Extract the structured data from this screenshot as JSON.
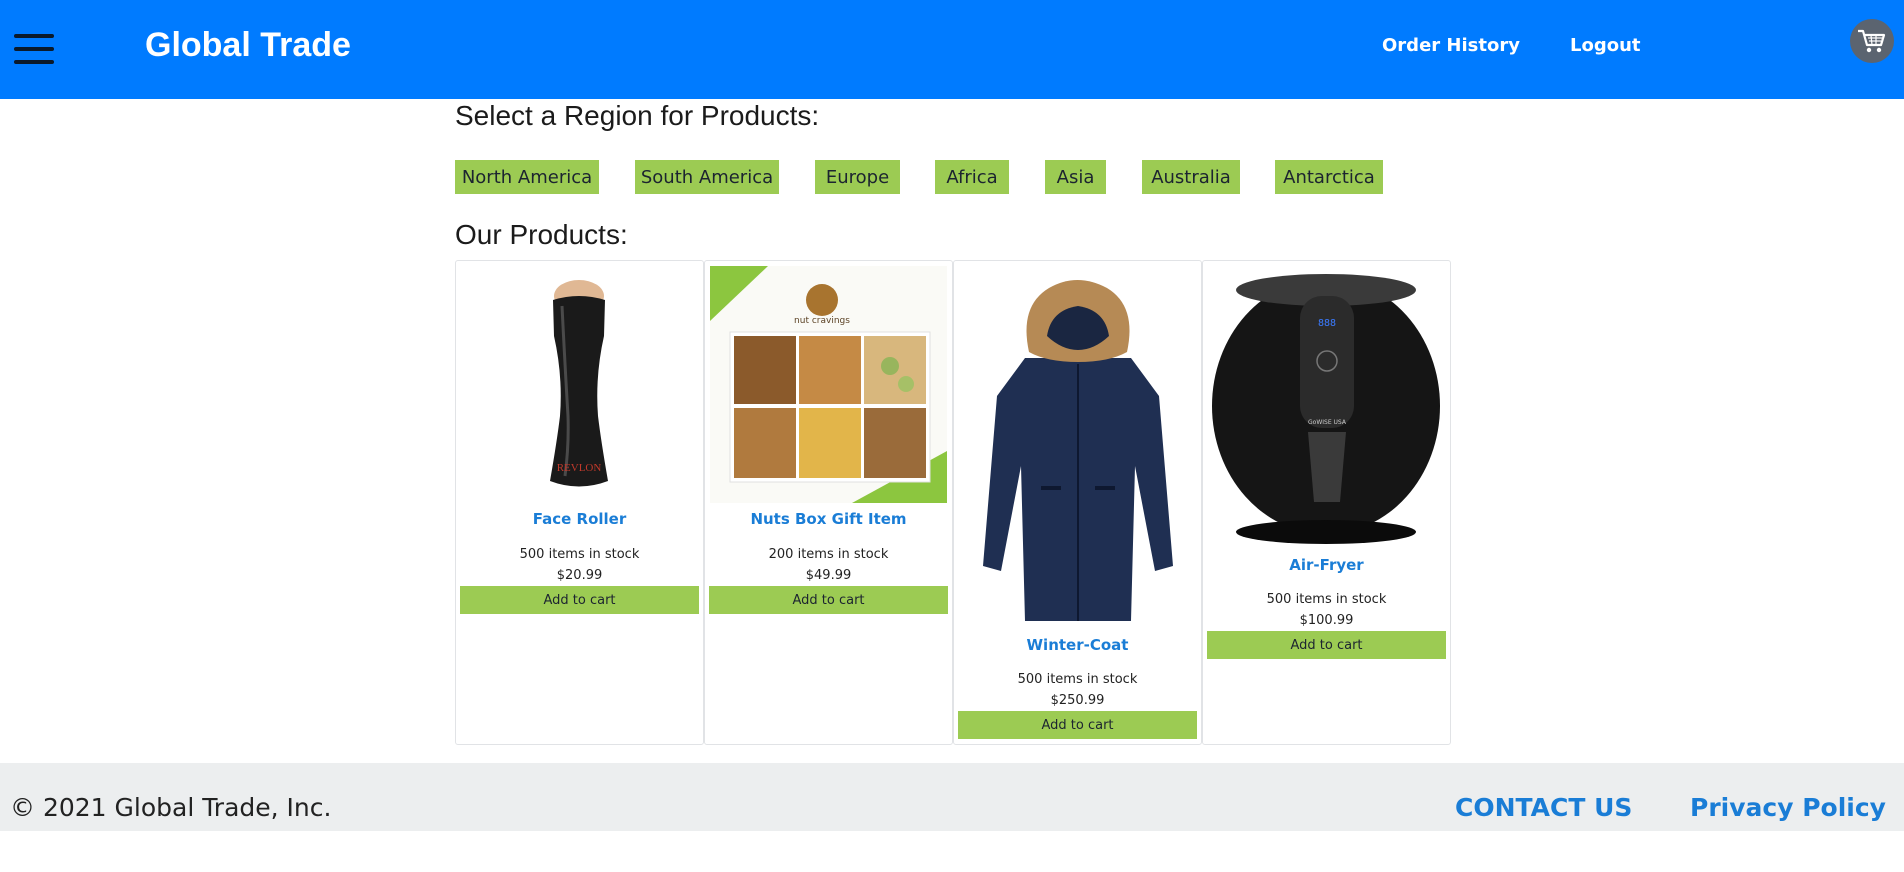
{
  "header": {
    "brand": "Global Trade",
    "nav": [
      "Order History",
      "Logout"
    ],
    "menu_icon": "hamburger-menu-icon",
    "cart_icon": "shopping-cart-icon"
  },
  "regions": {
    "title": "Select a Region for Products:",
    "items": [
      "North America",
      "South America",
      "Europe",
      "Africa",
      "Asia",
      "Australia",
      "Antarctica"
    ]
  },
  "products": {
    "title": "Our Products:",
    "items": [
      {
        "name": "Face Roller",
        "stock": "500 items in stock",
        "price": "$20.99",
        "button": "Add to cart",
        "image_brand": "REVLON"
      },
      {
        "name": "Nuts Box Gift Item",
        "stock": "200 items in stock",
        "price": "$49.99",
        "button": "Add to cart",
        "image_brand": "nut cravings"
      },
      {
        "name": "Winter-Coat",
        "stock": "500 items in stock",
        "price": "$250.99",
        "button": "Add to cart"
      },
      {
        "name": "Air-Fryer",
        "stock": "500 items in stock",
        "price": "$100.99",
        "button": "Add to cart",
        "image_brand": "GoWISE USA",
        "image_display": "888"
      }
    ]
  },
  "footer": {
    "copyright": "© 2021 Global Trade, Inc.",
    "links": [
      "CONTACT US",
      "Privacy Policy"
    ]
  },
  "colors": {
    "header_bg": "#007bff",
    "accent_green": "#9ccb53",
    "link_blue": "#1a7dd6",
    "footer_bg": "#eceeef"
  }
}
